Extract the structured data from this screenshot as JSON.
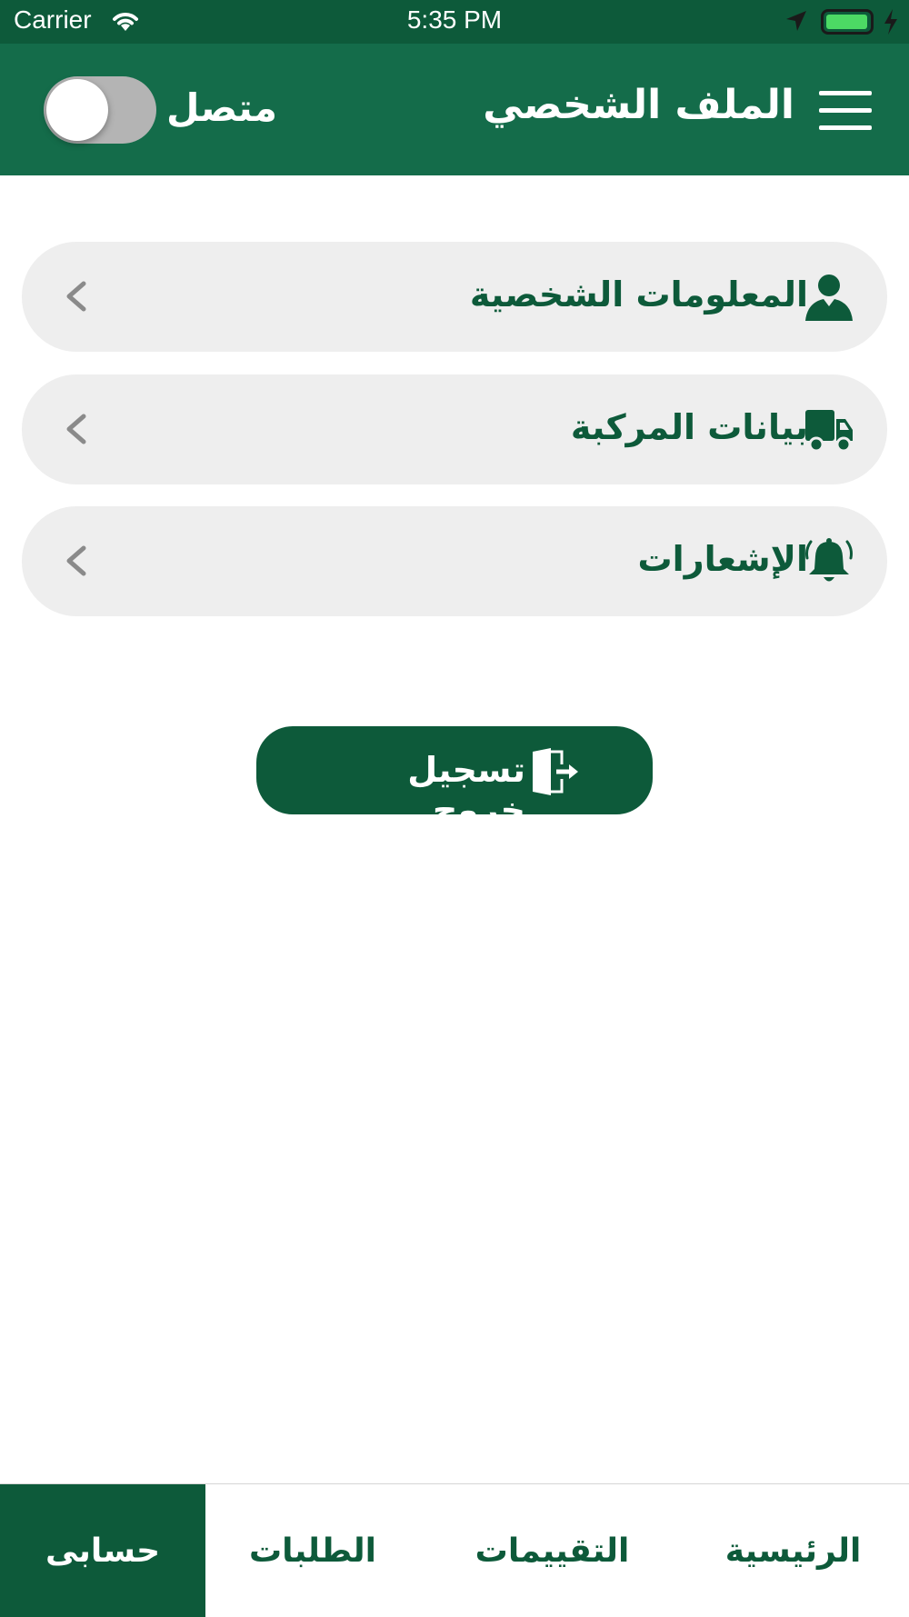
{
  "status_bar": {
    "carrier": "Carrier",
    "time": "5:35 PM",
    "battery_color": "#4cd964"
  },
  "header": {
    "title": "الملف الشخصي",
    "online_label": "متصل",
    "online_toggle_on": false,
    "background": "#146c4a"
  },
  "menu": {
    "items": [
      {
        "label": "المعلومات الشخصية",
        "icon": "person-icon"
      },
      {
        "label": "بيانات المركبة",
        "icon": "truck-icon"
      },
      {
        "label": "الإشعارات",
        "icon": "bell-icon"
      }
    ]
  },
  "logout": {
    "label": "تسجيل خروج",
    "icon": "logout-door-icon"
  },
  "tabs": [
    {
      "label": "الرئيسية",
      "active": false
    },
    {
      "label": "التقييمات",
      "active": false
    },
    {
      "label": "الطلبات",
      "active": false
    },
    {
      "label": "حسابى",
      "active": true
    }
  ],
  "colors": {
    "primary": "#0d5a3a",
    "header": "#146c4a",
    "item_background": "#eeeeee"
  }
}
